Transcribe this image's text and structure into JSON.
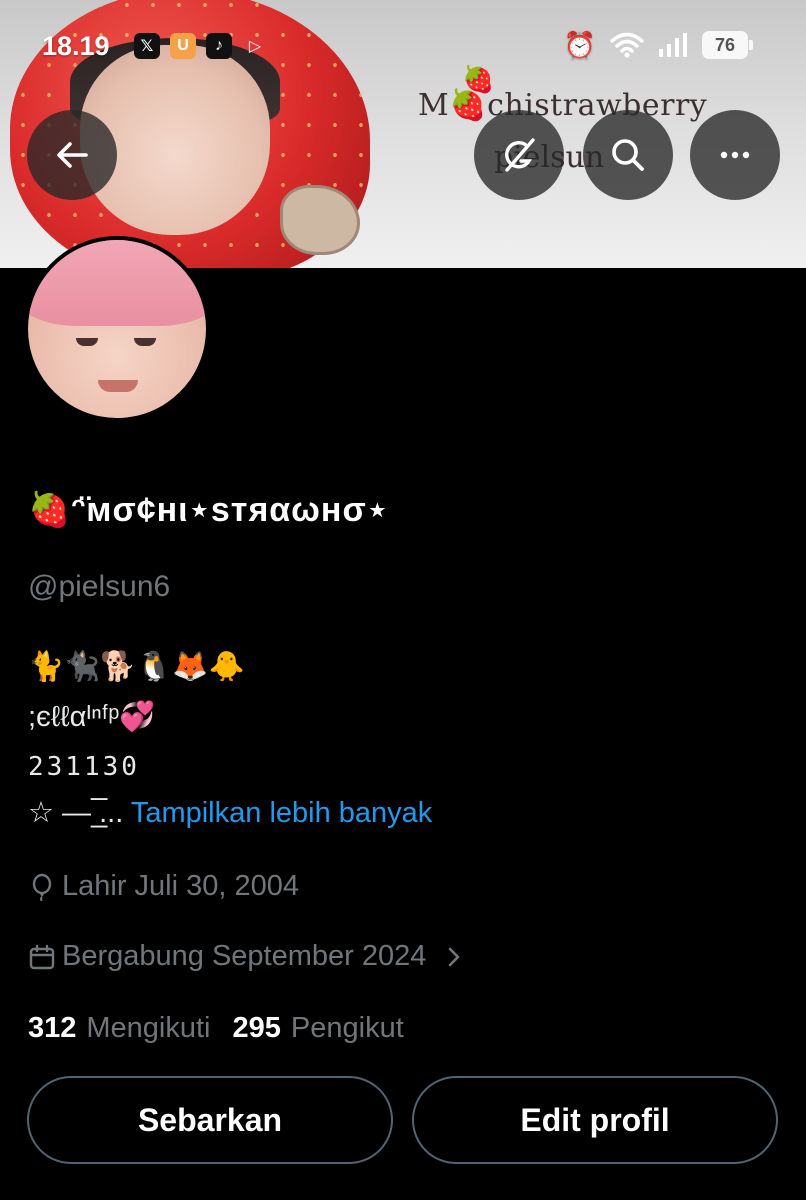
{
  "status_bar": {
    "time": "18.19",
    "apps": [
      {
        "name": "x-app-icon",
        "glyph": "𝕏",
        "bg": "#000000"
      },
      {
        "name": "ux-app-icon",
        "glyph": "U",
        "bg": "#f5a14a"
      },
      {
        "name": "tiktok-app-icon",
        "glyph": "♪",
        "bg": "#111111"
      },
      {
        "name": "play-app-icon",
        "glyph": "▷",
        "bg": "transparent"
      }
    ],
    "alarm_icon": "⏰",
    "wifi_icon": "wifi",
    "signal_icon": "signal",
    "battery_level": "76"
  },
  "banner": {
    "title": "M🍓chistrawberry",
    "subtitle": "pielsun"
  },
  "header_buttons": {
    "back_icon": "arrow-left",
    "grok_icon": "grok",
    "search_icon": "search",
    "more_icon": "more-horizontal"
  },
  "profile": {
    "display_name": "🍓ᵔ̈мσ¢нι⋆ѕтяαωнσ⋆",
    "handle": "@pielsun6",
    "bio": {
      "line1": "🐈🐈‍⬛🐕🐧🦊🐥",
      "line2": ";єℓℓαᴵⁿᶠᵖ💞",
      "line3": "231130",
      "line4_prefix": "☆ — ̲̅... ",
      "show_more": "Tampilkan lebih banyak"
    },
    "birth": "Lahir Juli 30, 2004",
    "joined": "Bergabung September 2024",
    "following_count": "312",
    "following_label": "Mengikuti",
    "followers_count": "295",
    "followers_label": "Pengikut"
  },
  "actions": {
    "share_label": "Sebarkan",
    "edit_label": "Edit profil"
  },
  "colors": {
    "background": "#000000",
    "text_primary": "#e7e9ea",
    "text_secondary": "#71767b",
    "link": "#1d9bf0",
    "button_border": "#536471"
  }
}
